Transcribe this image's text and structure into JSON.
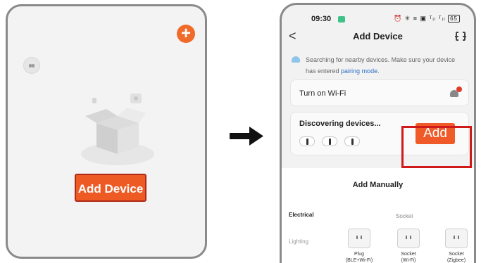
{
  "left_screen": {
    "add_button_label": "Add Device",
    "plus_icon": "plus-circle-icon",
    "avatar_icon": "robot-avatar-icon",
    "illustration": "empty-box-illustration"
  },
  "right_screen": {
    "status": {
      "time": "09:30",
      "icons_text": "⏰ ✳ ≡ ▣ ᵀᵢₗ ᵀᵢₗ",
      "battery": "65"
    },
    "nav": {
      "title": "Add Device",
      "back_label": "<",
      "scan_icon": "scan-icon"
    },
    "hint": {
      "line1": "Searching for nearby devices. Make sure your device",
      "line2_prefix": "has entered ",
      "link": "pairing mode",
      "line2_suffix": "."
    },
    "wifi": {
      "label": "Turn on Wi-Fi",
      "icon": "wifi-icon"
    },
    "discover": {
      "title": "Discovering devices...",
      "add_label": "Add"
    },
    "manual": {
      "title": "Add Manually",
      "categories": [
        "Electrical",
        "Lighting"
      ],
      "socket_header": "Socket",
      "devices": [
        {
          "label_line1": "Plug",
          "label_line2": "(BLE+Wi-Fi)"
        },
        {
          "label_line1": "Socket",
          "label_line2": "(Wi-Fi)"
        },
        {
          "label_line1": "Socket",
          "label_line2": "(Zigbee)"
        }
      ]
    }
  },
  "colors": {
    "accent": "#ee5a24",
    "highlight": "#d01919",
    "link": "#2d6ec8"
  }
}
